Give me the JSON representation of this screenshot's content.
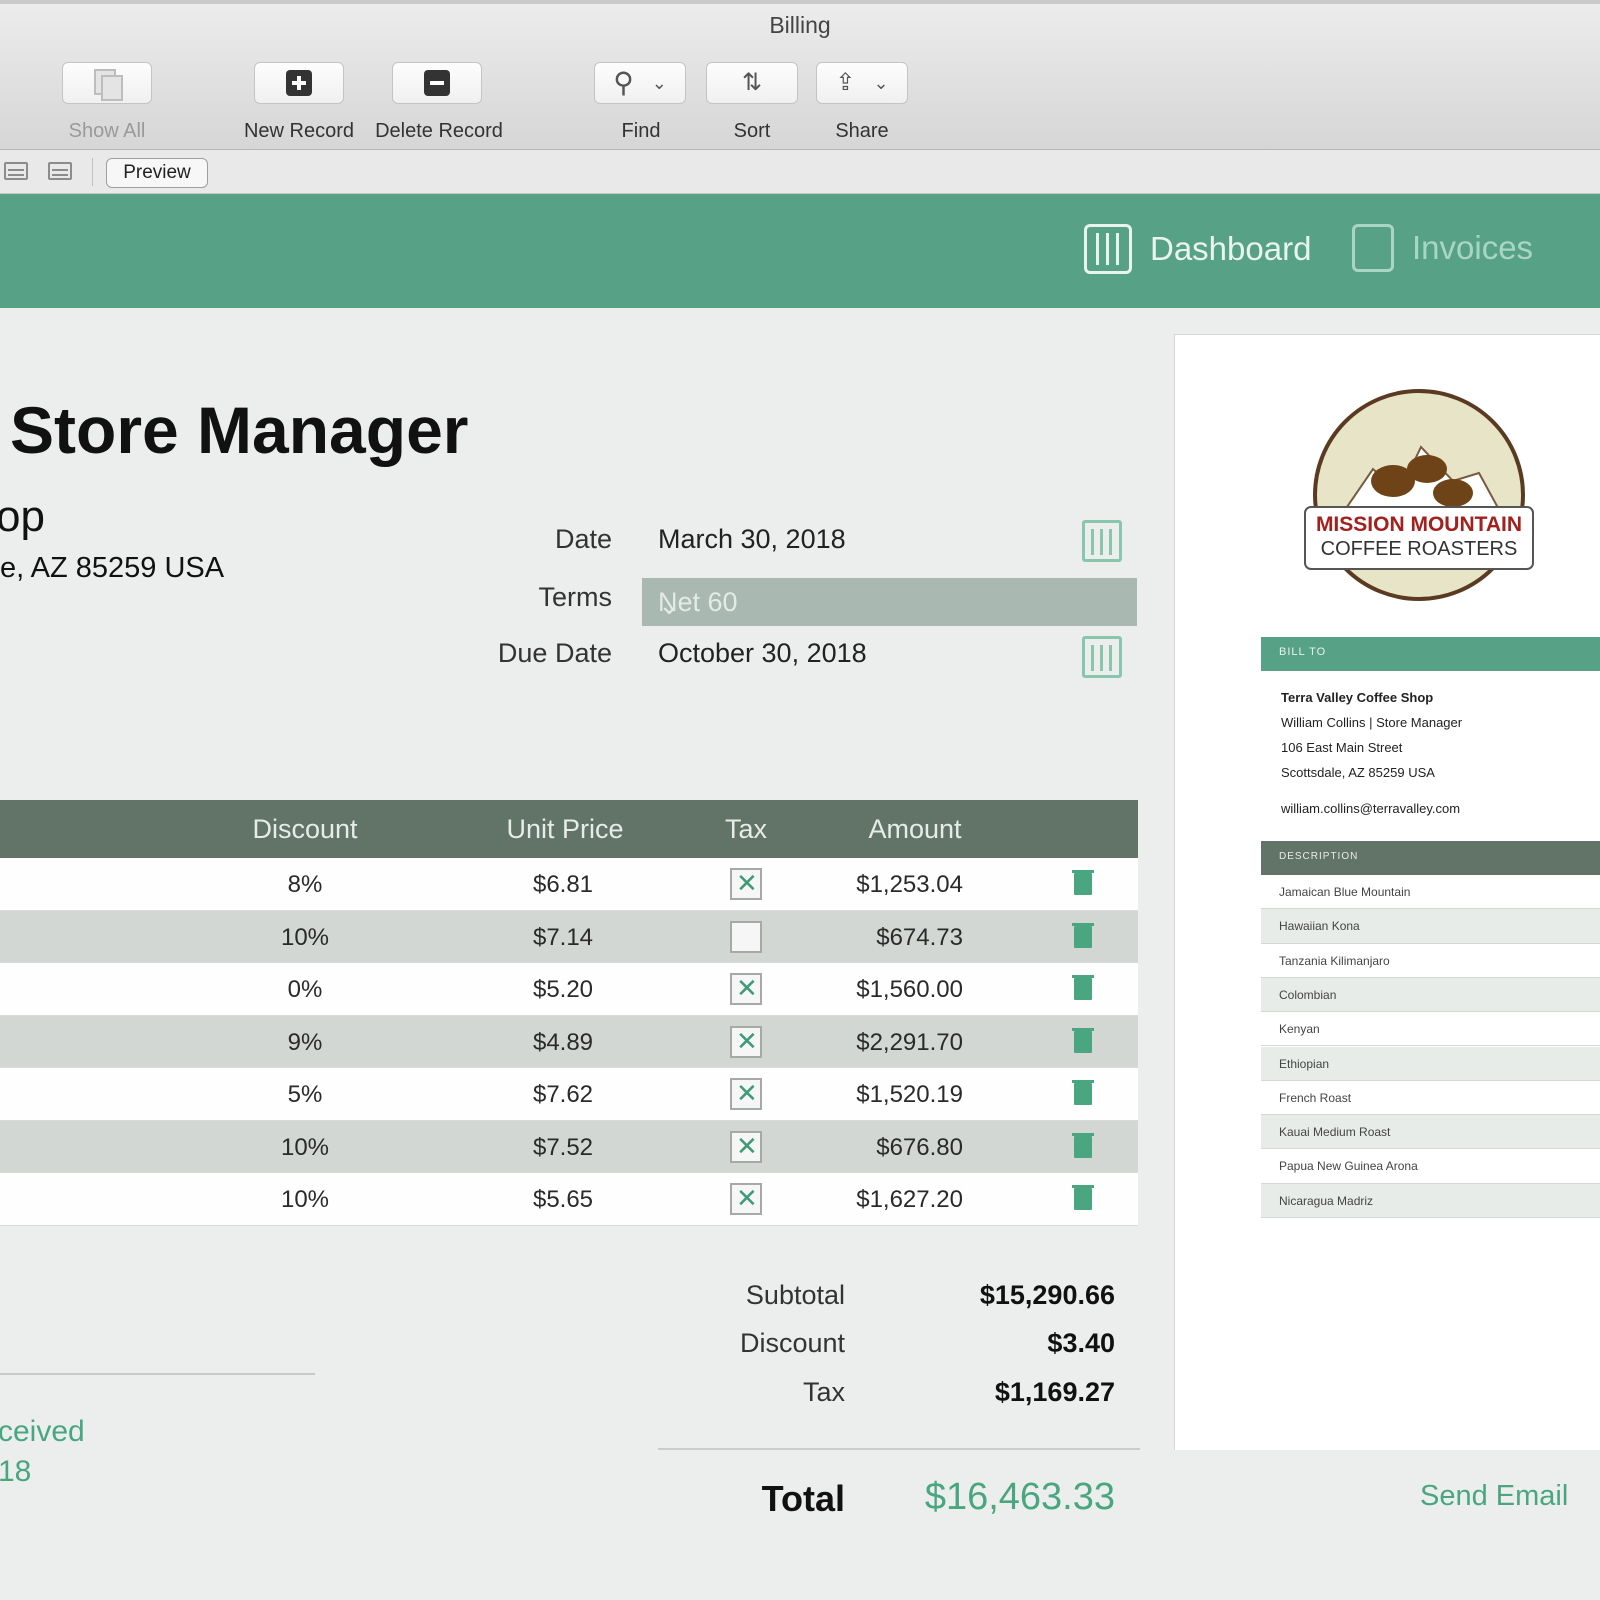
{
  "window": {
    "title": "Billing"
  },
  "toolbar": {
    "show_all": "Show All",
    "new_record": "New Record",
    "delete_record": "Delete Record",
    "find": "Find",
    "sort": "Sort",
    "share": "Share"
  },
  "toolbar2": {
    "preview": "Preview"
  },
  "nav": {
    "dashboard": "Dashboard",
    "invoices": "Invoices"
  },
  "header": {
    "title": "Store Manager",
    "company_partial": "op",
    "address_partial": "e, AZ 85259 USA"
  },
  "fields": {
    "date_label": "Date",
    "date_value": "March 30, 2018",
    "terms_label": "Terms",
    "terms_value": "Net 60",
    "due_label": "Due Date",
    "due_value": "October 30, 2018"
  },
  "table": {
    "columns": {
      "discount": "Discount",
      "unit_price": "Unit Price",
      "tax": "Tax",
      "amount": "Amount"
    },
    "rows": [
      {
        "discount": "8%",
        "unit_price": "$6.81",
        "tax": true,
        "amount": "$1,253.04"
      },
      {
        "discount": "10%",
        "unit_price": "$7.14",
        "tax": false,
        "amount": "$674.73"
      },
      {
        "discount": "0%",
        "unit_price": "$5.20",
        "tax": true,
        "amount": "$1,560.00"
      },
      {
        "discount": "9%",
        "unit_price": "$4.89",
        "tax": true,
        "amount": "$2,291.70"
      },
      {
        "discount": "5%",
        "unit_price": "$7.62",
        "tax": true,
        "amount": "$1,520.19"
      },
      {
        "discount": "10%",
        "unit_price": "$7.52",
        "tax": true,
        "amount": "$676.80"
      },
      {
        "discount": "10%",
        "unit_price": "$5.65",
        "tax": true,
        "amount": "$1,627.20"
      }
    ]
  },
  "totals": {
    "subtotal_label": "Subtotal",
    "subtotal": "$15,290.66",
    "discount_label": "Discount",
    "discount": "$3.40",
    "tax_label": "Tax",
    "tax": "$1,169.27",
    "total_label": "Total",
    "total": "$16,463.33"
  },
  "payment": {
    "received_partial": "ceived",
    "date_partial": "18"
  },
  "preview": {
    "logo_line1": "MISSION MOUNTAIN",
    "logo_line2": "COFFEE ROASTERS",
    "bill_to": "BILL TO",
    "bill_lines": [
      "Terra Valley Coffee Shop",
      "William Collins | Store Manager",
      "106 East Main Street",
      "Scottsdale, AZ 85259 USA",
      "william.collins@terravalley.com"
    ],
    "description": "DESCRIPTION",
    "items": [
      "Jamaican Blue Mountain",
      "Hawaiian Kona",
      "Tanzania Kilimanjaro",
      "Colombian",
      "Kenyan",
      "Ethiopian",
      "French Roast",
      "Kauai Medium Roast",
      "Papua New Guinea Arona",
      "Nicaragua Madriz"
    ],
    "send_email": "Send Email"
  },
  "colors": {
    "accent": "#57a287",
    "header_dark": "#627468",
    "money_green": "#4aa681"
  }
}
